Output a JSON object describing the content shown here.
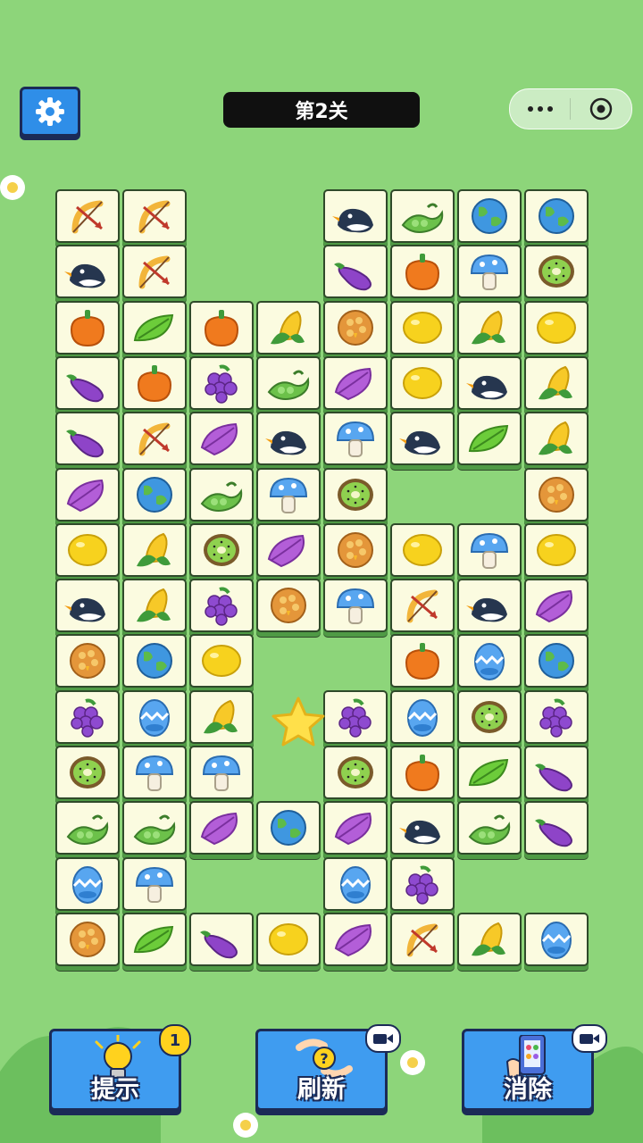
{
  "header": {
    "level_label": "第2关"
  },
  "toolbar": {
    "hint_label": "提示",
    "hint_count": "1",
    "refresh_label": "刷新",
    "remove_label": "消除"
  },
  "board": {
    "columns": 8,
    "rows": 14,
    "tiles": [
      {
        "row": 0,
        "col": 0,
        "icon": "bow-arrow"
      },
      {
        "row": 0,
        "col": 1,
        "icon": "bow-arrow"
      },
      {
        "row": 0,
        "col": 4,
        "icon": "penguin"
      },
      {
        "row": 0,
        "col": 5,
        "icon": "pea-pod"
      },
      {
        "row": 0,
        "col": 6,
        "icon": "earth"
      },
      {
        "row": 0,
        "col": 7,
        "icon": "earth"
      },
      {
        "row": 1,
        "col": 0,
        "icon": "penguin"
      },
      {
        "row": 1,
        "col": 1,
        "icon": "bow-arrow"
      },
      {
        "row": 1,
        "col": 4,
        "icon": "eggplant"
      },
      {
        "row": 1,
        "col": 5,
        "icon": "pepper"
      },
      {
        "row": 1,
        "col": 6,
        "icon": "mushroom"
      },
      {
        "row": 1,
        "col": 7,
        "icon": "kiwi"
      },
      {
        "row": 2,
        "col": 0,
        "icon": "pepper"
      },
      {
        "row": 2,
        "col": 1,
        "icon": "leaf"
      },
      {
        "row": 2,
        "col": 2,
        "icon": "pepper"
      },
      {
        "row": 2,
        "col": 3,
        "icon": "corn"
      },
      {
        "row": 2,
        "col": 4,
        "icon": "honeycomb"
      },
      {
        "row": 2,
        "col": 5,
        "icon": "lemon"
      },
      {
        "row": 2,
        "col": 6,
        "icon": "corn"
      },
      {
        "row": 2,
        "col": 7,
        "icon": "lemon"
      },
      {
        "row": 3,
        "col": 0,
        "icon": "eggplant"
      },
      {
        "row": 3,
        "col": 1,
        "icon": "pepper"
      },
      {
        "row": 3,
        "col": 2,
        "icon": "grape"
      },
      {
        "row": 3,
        "col": 3,
        "icon": "pea-pod"
      },
      {
        "row": 3,
        "col": 4,
        "icon": "feather"
      },
      {
        "row": 3,
        "col": 5,
        "icon": "lemon"
      },
      {
        "row": 3,
        "col": 6,
        "icon": "penguin"
      },
      {
        "row": 3,
        "col": 7,
        "icon": "corn"
      },
      {
        "row": 4,
        "col": 0,
        "icon": "eggplant"
      },
      {
        "row": 4,
        "col": 1,
        "icon": "bow-arrow"
      },
      {
        "row": 4,
        "col": 2,
        "icon": "feather"
      },
      {
        "row": 4,
        "col": 3,
        "icon": "penguin"
      },
      {
        "row": 4,
        "col": 4,
        "icon": "mushroom"
      },
      {
        "row": 4,
        "col": 5,
        "icon": "penguin"
      },
      {
        "row": 4,
        "col": 6,
        "icon": "leaf"
      },
      {
        "row": 4,
        "col": 7,
        "icon": "corn"
      },
      {
        "row": 5,
        "col": 0,
        "icon": "feather"
      },
      {
        "row": 5,
        "col": 1,
        "icon": "earth"
      },
      {
        "row": 5,
        "col": 2,
        "icon": "pea-pod"
      },
      {
        "row": 5,
        "col": 3,
        "icon": "mushroom"
      },
      {
        "row": 5,
        "col": 4,
        "icon": "kiwi"
      },
      {
        "row": 5,
        "col": 7,
        "icon": "honeycomb"
      },
      {
        "row": 6,
        "col": 0,
        "icon": "lemon"
      },
      {
        "row": 6,
        "col": 1,
        "icon": "corn"
      },
      {
        "row": 6,
        "col": 2,
        "icon": "kiwi"
      },
      {
        "row": 6,
        "col": 3,
        "icon": "feather"
      },
      {
        "row": 6,
        "col": 4,
        "icon": "honeycomb"
      },
      {
        "row": 6,
        "col": 5,
        "icon": "lemon"
      },
      {
        "row": 6,
        "col": 6,
        "icon": "mushroom"
      },
      {
        "row": 6,
        "col": 7,
        "icon": "lemon"
      },
      {
        "row": 7,
        "col": 0,
        "icon": "penguin"
      },
      {
        "row": 7,
        "col": 1,
        "icon": "corn"
      },
      {
        "row": 7,
        "col": 2,
        "icon": "grape"
      },
      {
        "row": 7,
        "col": 3,
        "icon": "honeycomb"
      },
      {
        "row": 7,
        "col": 4,
        "icon": "mushroom"
      },
      {
        "row": 7,
        "col": 5,
        "icon": "bow-arrow"
      },
      {
        "row": 7,
        "col": 6,
        "icon": "penguin"
      },
      {
        "row": 7,
        "col": 7,
        "icon": "feather"
      },
      {
        "row": 8,
        "col": 0,
        "icon": "honeycomb"
      },
      {
        "row": 8,
        "col": 1,
        "icon": "earth"
      },
      {
        "row": 8,
        "col": 2,
        "icon": "lemon"
      },
      {
        "row": 8,
        "col": 5,
        "icon": "pepper"
      },
      {
        "row": 8,
        "col": 6,
        "icon": "easter-egg"
      },
      {
        "row": 8,
        "col": 7,
        "icon": "earth"
      },
      {
        "row": 9,
        "col": 0,
        "icon": "grape"
      },
      {
        "row": 9,
        "col": 1,
        "icon": "easter-egg"
      },
      {
        "row": 9,
        "col": 2,
        "icon": "corn"
      },
      {
        "row": 9,
        "col": 4,
        "icon": "grape"
      },
      {
        "row": 9,
        "col": 5,
        "icon": "easter-egg"
      },
      {
        "row": 9,
        "col": 6,
        "icon": "kiwi"
      },
      {
        "row": 9,
        "col": 7,
        "icon": "grape"
      },
      {
        "row": 10,
        "col": 0,
        "icon": "kiwi"
      },
      {
        "row": 10,
        "col": 1,
        "icon": "mushroom"
      },
      {
        "row": 10,
        "col": 2,
        "icon": "mushroom"
      },
      {
        "row": 10,
        "col": 4,
        "icon": "kiwi"
      },
      {
        "row": 10,
        "col": 5,
        "icon": "pepper"
      },
      {
        "row": 10,
        "col": 6,
        "icon": "leaf"
      },
      {
        "row": 10,
        "col": 7,
        "icon": "eggplant"
      },
      {
        "row": 11,
        "col": 0,
        "icon": "pea-pod"
      },
      {
        "row": 11,
        "col": 1,
        "icon": "pea-pod"
      },
      {
        "row": 11,
        "col": 2,
        "icon": "feather"
      },
      {
        "row": 11,
        "col": 3,
        "icon": "earth"
      },
      {
        "row": 11,
        "col": 4,
        "icon": "feather"
      },
      {
        "row": 11,
        "col": 5,
        "icon": "penguin"
      },
      {
        "row": 11,
        "col": 6,
        "icon": "pea-pod"
      },
      {
        "row": 11,
        "col": 7,
        "icon": "eggplant"
      },
      {
        "row": 12,
        "col": 0,
        "icon": "easter-egg"
      },
      {
        "row": 12,
        "col": 1,
        "icon": "mushroom"
      },
      {
        "row": 12,
        "col": 4,
        "icon": "easter-egg"
      },
      {
        "row": 12,
        "col": 5,
        "icon": "grape"
      },
      {
        "row": 13,
        "col": 0,
        "icon": "honeycomb"
      },
      {
        "row": 13,
        "col": 1,
        "icon": "leaf"
      },
      {
        "row": 13,
        "col": 2,
        "icon": "eggplant"
      },
      {
        "row": 13,
        "col": 3,
        "icon": "lemon"
      },
      {
        "row": 13,
        "col": 4,
        "icon": "feather"
      },
      {
        "row": 13,
        "col": 5,
        "icon": "bow-arrow"
      },
      {
        "row": 13,
        "col": 6,
        "icon": "corn"
      },
      {
        "row": 13,
        "col": 7,
        "icon": "easter-egg"
      }
    ]
  },
  "colors": {
    "background": "#8dd57a",
    "button_blue": "#3f9cf0",
    "tile_face": "#fbfbe0",
    "tile_edge": "#4f9a45"
  }
}
